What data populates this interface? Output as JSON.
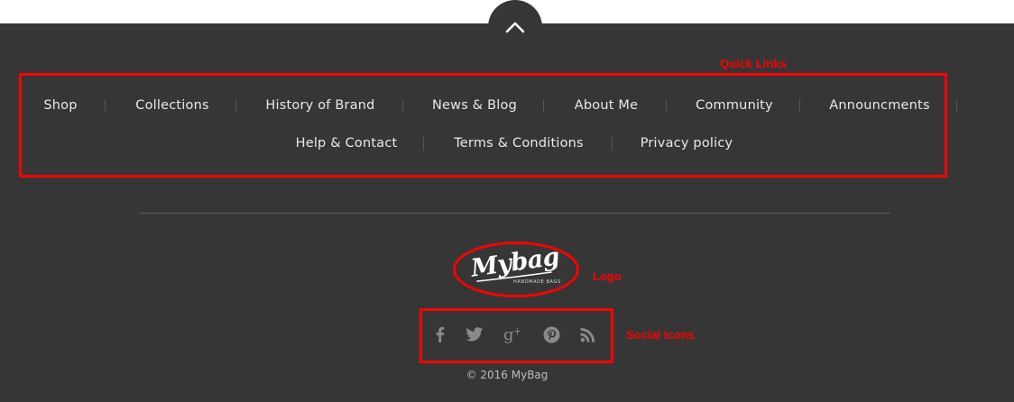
{
  "colors": {
    "footer_bg": "#363636",
    "link_text": "#e8e8e8",
    "icon_gray": "#8a8a8a",
    "annotation_red": "#ff0000"
  },
  "scroll_top": {
    "icon": "chevron-up-icon"
  },
  "quick_links": {
    "row1": [
      "Shop",
      "Collections",
      "History of Brand",
      "News & Blog",
      "About Me",
      "Community",
      "Announcments"
    ],
    "row2": [
      "Help & Contact",
      "Terms & Conditions",
      "Privacy policy"
    ]
  },
  "logo": {
    "name": "Mybag",
    "tagline": "HANDMADE BAGS"
  },
  "social": {
    "icons": [
      "facebook-icon",
      "twitter-icon",
      "google-plus-icon",
      "pinterest-icon",
      "rss-icon"
    ]
  },
  "copyright": "© 2016 MyBag",
  "annotations": {
    "quick_links": "Quick Links",
    "logo": "Logo",
    "social_icons": "Social Icons"
  }
}
